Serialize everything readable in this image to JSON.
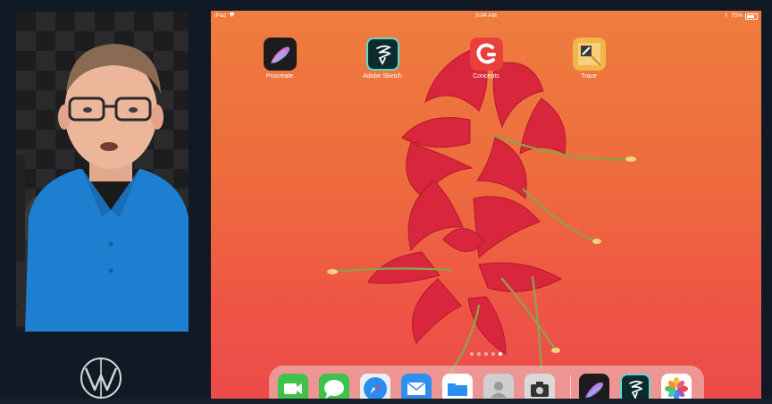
{
  "status_bar": {
    "device": "iPad",
    "time": "9:04 AM",
    "battery": "75%",
    "battery_level": 0.75
  },
  "home_apps": [
    {
      "label": "Procreate",
      "icon": "procreate-icon"
    },
    {
      "label": "Adobe Sketch",
      "icon": "adobe-sketch-icon"
    },
    {
      "label": "Concepts",
      "icon": "concepts-icon"
    },
    {
      "label": "Trace",
      "icon": "trace-icon"
    }
  ],
  "page_dots": {
    "count": 5,
    "active": 4
  },
  "dock": [
    {
      "icon": "facetime-icon"
    },
    {
      "icon": "messages-icon"
    },
    {
      "icon": "safari-icon"
    },
    {
      "icon": "mail-icon"
    },
    {
      "icon": "files-icon"
    },
    {
      "icon": "contacts-icon"
    },
    {
      "icon": "camera-icon"
    },
    {
      "icon": "procreate-dock-icon"
    },
    {
      "icon": "adobe-sketch-dock-icon"
    },
    {
      "icon": "photos-icon"
    }
  ],
  "colors": {
    "background": "#0f1a24",
    "wallpaper_top": "#ef7d3f",
    "wallpaper_bottom": "#ec4a4a",
    "flower": "#d8263c",
    "shirt": "#1e7ed0"
  },
  "webcam": {
    "subject": "presenter-webcam"
  },
  "brand": {
    "logo": "w-monogram-logo"
  }
}
